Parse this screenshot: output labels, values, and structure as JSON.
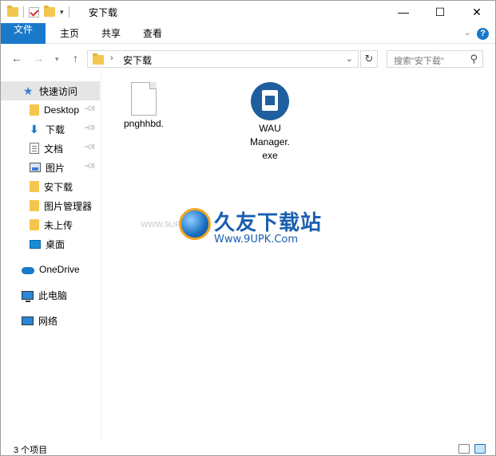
{
  "window": {
    "title": "安下载",
    "controls": {
      "minimize": "—",
      "maximize": "☐",
      "close": "✕"
    }
  },
  "ribbon": {
    "tabs": [
      {
        "label": "文件"
      },
      {
        "label": "主页"
      },
      {
        "label": "共享"
      },
      {
        "label": "查看"
      }
    ],
    "help": "?"
  },
  "address": {
    "path": "安下载",
    "separator": "›"
  },
  "search": {
    "placeholder": "搜索\"安下载\""
  },
  "sidebar": {
    "quick_access": "快速访问",
    "items": [
      {
        "label": "Desktop",
        "pinned": true
      },
      {
        "label": "下载",
        "pinned": true
      },
      {
        "label": "文档",
        "pinned": true
      },
      {
        "label": "图片",
        "pinned": true
      },
      {
        "label": "安下载",
        "pinned": false
      },
      {
        "label": "图片管理器",
        "pinned": false
      },
      {
        "label": "未上传",
        "pinned": false
      },
      {
        "label": "桌面",
        "pinned": false
      }
    ],
    "onedrive": "OneDrive",
    "this_pc": "此电脑",
    "network": "网络"
  },
  "files": [
    {
      "name": "pnghhbd.",
      "type": "generic"
    },
    {
      "name": "WAU Manager.exe",
      "line1": "WAU",
      "line2": "Manager.",
      "line3": "exe",
      "type": "exe"
    }
  ],
  "watermark": {
    "title": "久友下载站",
    "url": "Www.9UPK.Com",
    "small": "WWW.9UPK.COM"
  },
  "status": {
    "count": "3 个项目"
  },
  "colors": {
    "accent": "#1979ca",
    "folder": "#f4c64f",
    "selected": "#e5e5e5"
  }
}
